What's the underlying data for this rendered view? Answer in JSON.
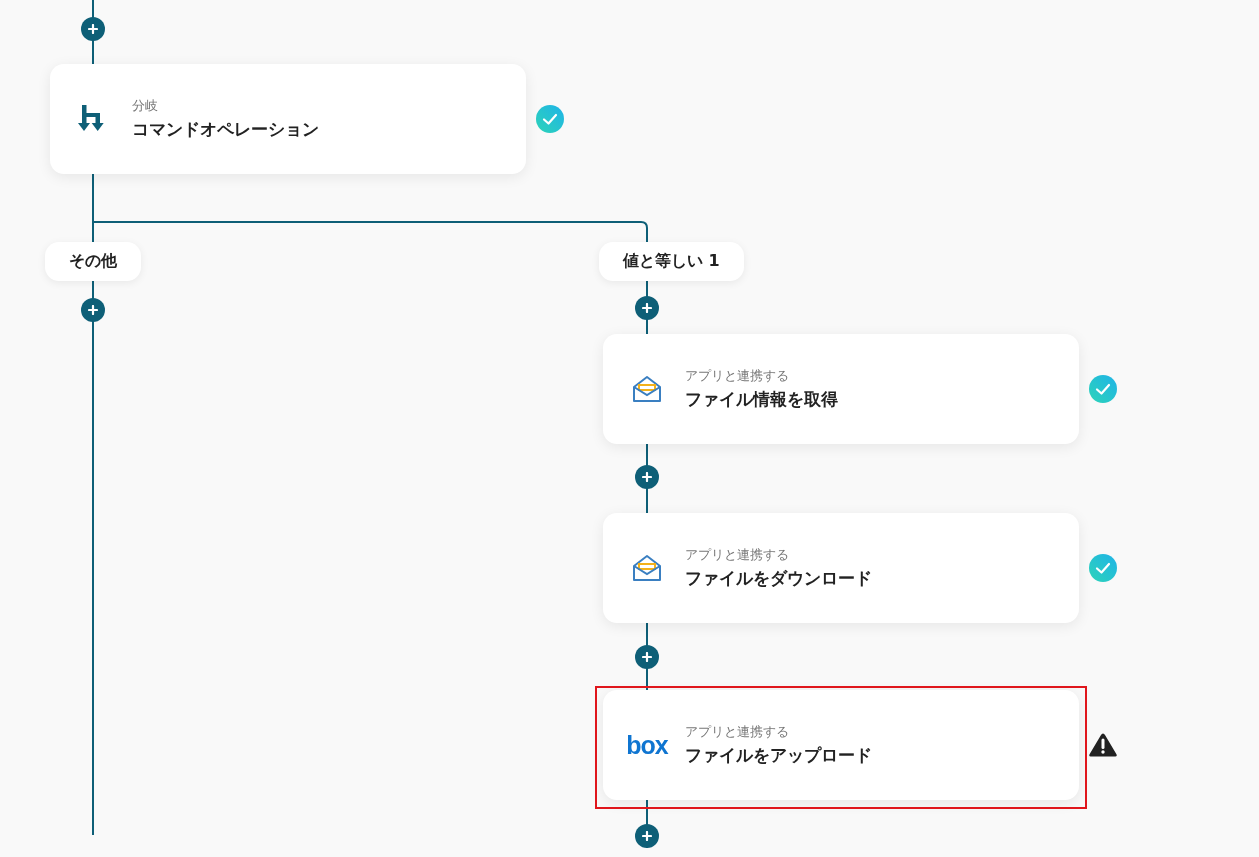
{
  "steps": [
    {
      "kind": "branch",
      "subtitle": "分岐",
      "title": "コマンドオペレーション",
      "completed": true,
      "warning": false,
      "highlighted": false
    },
    {
      "kind": "mail",
      "subtitle": "アプリと連携する",
      "title": "ファイル情報を取得",
      "completed": true,
      "warning": false,
      "highlighted": false
    },
    {
      "kind": "mail",
      "subtitle": "アプリと連携する",
      "title": "ファイルをダウンロード",
      "completed": true,
      "warning": false,
      "highlighted": false
    },
    {
      "kind": "box",
      "logo_text": "box",
      "subtitle": "アプリと連携する",
      "title": "ファイルをアップロード",
      "completed": false,
      "warning": true,
      "highlighted": true
    }
  ],
  "branch_labels": [
    "その他",
    "値と等しい 1"
  ]
}
